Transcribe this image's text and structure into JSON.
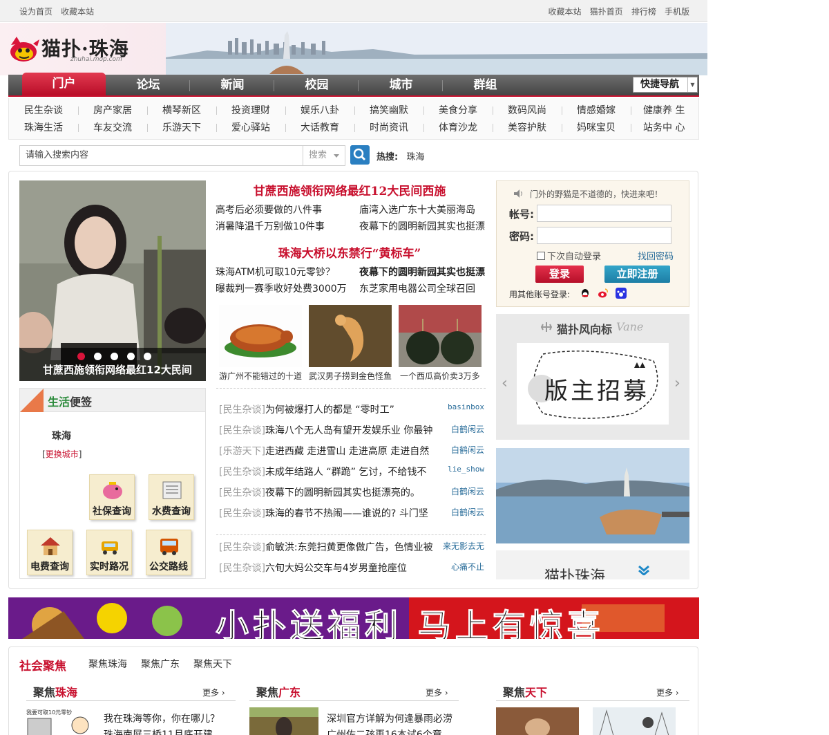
{
  "topbar": {
    "left": [
      "设为首页",
      "收藏本站"
    ],
    "right": [
      "收藏本站",
      "猫扑首页",
      "排行榜",
      "手机版"
    ]
  },
  "header": {
    "logo_text": "猫扑·珠海",
    "logo_sub": "zhuhai.mop.com"
  },
  "nav": {
    "items": [
      "门户",
      "论坛",
      "新闻",
      "校园",
      "城市",
      "群组"
    ],
    "active": "门户",
    "quick_nav": "快捷导航"
  },
  "subnav": {
    "row1": [
      "民生杂谈",
      "房产家居",
      "横琴新区",
      "投资理财",
      "娱乐八卦",
      "搞笑幽默",
      "美食分享",
      "数码风尚",
      "情感婚嫁",
      "健康养 生"
    ],
    "row2": [
      "珠海生活",
      "车友交流",
      "乐游天下",
      "爱心驿站",
      "大话教育",
      "时尚资讯",
      "体育沙龙",
      "美容护肤",
      "妈咪宝贝",
      "站务中 心"
    ]
  },
  "search": {
    "placeholder": "请输入搜索内容",
    "select": "搜索",
    "hot_label": "热搜:",
    "hot_term": "珠海"
  },
  "slider": {
    "caption": "甘蔗西施领衔网络最红12大民间",
    "dots": 5,
    "active_dot": 1
  },
  "headlines": {
    "h1": "甘蔗西施领衔网络最红12大民间西施",
    "h1_links": [
      "高考后必须要做的八件事",
      "庙湾入选广东十大美丽海岛",
      "消暑降温千万别做10件事",
      "夜幕下的圆明新园其实也挺漂"
    ],
    "h2": "珠海大桥以东禁行“黄标车”",
    "h2_links": [
      "珠海ATM机可取10元零钞？",
      "夜幕下的圆明新园其实也挺漂",
      "曝裁判一赛季收好处费3000万",
      "东芝家用电器公司全球召回"
    ]
  },
  "pictures": [
    {
      "caption": "游广州不能错过的十道"
    },
    {
      "caption": "武汉男子捞到金色怪鱼"
    },
    {
      "caption": "一个西瓜高价卖3万多"
    }
  ],
  "forum": [
    {
      "cat": "[民生杂谈]",
      "title": "为何被爆打人的都是 “零时工”",
      "user": "basinbox"
    },
    {
      "cat": "[民生杂谈]",
      "title": "珠海八个无人岛有望开发娱乐业 你最钟",
      "user": "白鹤闲云"
    },
    {
      "cat": "[乐游天下]",
      "title": "走进西藏 走进雪山 走进高原 走进自然",
      "user": "白鹤闲云"
    },
    {
      "cat": "[民生杂谈]",
      "title": "未成年结路人 “群跪” 乞讨，不给钱不",
      "user": "lie_show"
    },
    {
      "cat": "[民生杂谈]",
      "title": "夜幕下的圆明新园其实也挺漂亮的。",
      "user": "白鹤闲云"
    },
    {
      "cat": "[民生杂谈]",
      "title": "珠海的春节不热闹——谁说的? 斗门坚",
      "user": "白鹤闲云"
    },
    {
      "cat": "[民生杂谈]",
      "title": "俞敏洪:东莞扫黄更像做广告，色情业被",
      "user": "来无影去无"
    },
    {
      "cat": "[民生杂谈]",
      "title": "六旬大妈公交车与4岁男童抢座位",
      "user": "心痛不止"
    }
  ],
  "life": {
    "title_green": "生活",
    "title_rest": "便签",
    "city": "珠海",
    "change_prefix": "[",
    "change_link": "更换城市",
    "change_suffix": "]",
    "services": [
      "社保查询",
      "水费查询",
      "电费查询",
      "实时路况",
      "公交路线"
    ]
  },
  "login": {
    "tip": "门外的野猫是不道德的，快进来吧！",
    "account_label": "帐号:",
    "password_label": "密码:",
    "remember": "下次自动登录",
    "forgot": "找回密码",
    "login_btn": "登录",
    "register_btn": "立即注册",
    "other": "用其他账号登录:"
  },
  "vane": {
    "title": "猫扑风向标",
    "script": "Vane",
    "card_text": "版主招募"
  },
  "promo": {
    "text": "猫扑珠海"
  },
  "banner": {
    "text": "小扑送福利 马上有惊喜"
  },
  "bottom": {
    "title": "社会聚焦",
    "tabs": [
      "聚焦珠海",
      "聚焦广东",
      "聚焦天下"
    ],
    "columns": [
      {
        "pre": "聚焦",
        "hi": "珠海",
        "more": "更多"
      },
      {
        "pre": "聚焦",
        "hi": "广东",
        "more": "更多"
      },
      {
        "pre": "聚焦",
        "hi": "天下",
        "more": "更多"
      }
    ],
    "lines": [
      "我在珠海等你，你在哪儿？",
      "珠海南屏三桥11月底开建",
      "深圳官方详解为何逢暴雨必涝",
      "广州佐二孩再16本试6个章"
    ],
    "sign_text": "我要可取10元零钞"
  },
  "colors": {
    "accent_red": "#c8102e",
    "link_blue": "#2a6d9a",
    "green": "#2a8a3a"
  }
}
